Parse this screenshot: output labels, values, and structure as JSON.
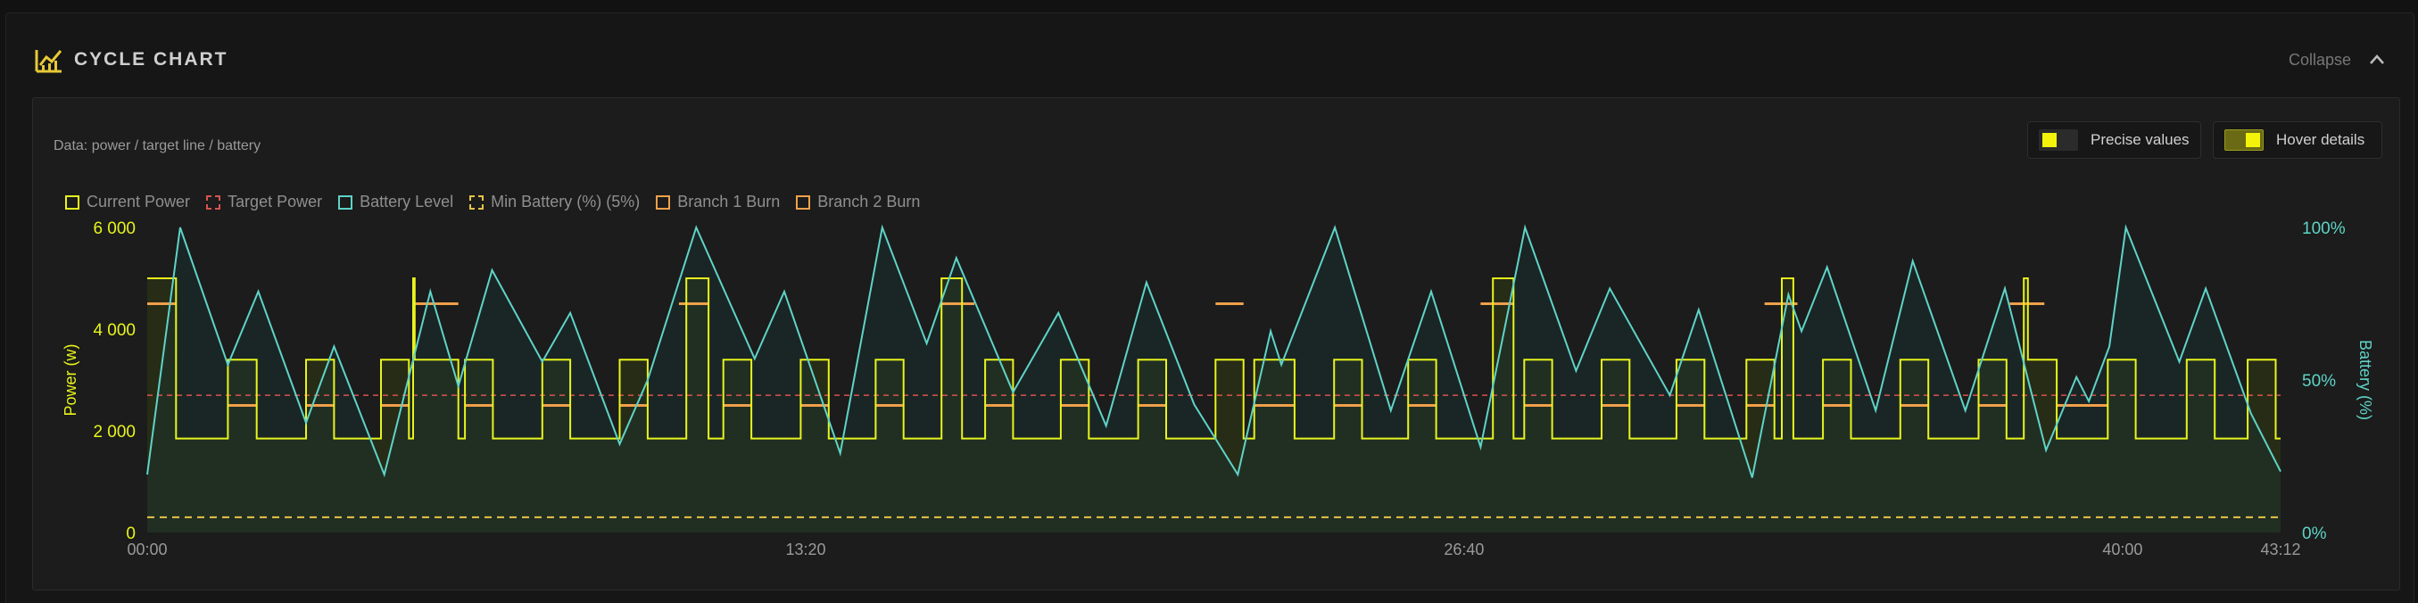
{
  "header": {
    "title": "CYCLE CHART",
    "icon": "chart-line-icon",
    "collapse_label": "Collapse",
    "collapse_icon": "chevron-up-icon"
  },
  "panel": {
    "subtitle": "Data: power / target line / battery",
    "precise_label": "Precise values",
    "precise_on": false,
    "hover_label": "Hover details",
    "hover_on": true
  },
  "colors": {
    "power": "#e8f41c",
    "target": "#d9534f",
    "battery": "#5fd3c8",
    "min_battery": "#e8c347",
    "branch1": "#f0a04b",
    "branch2": "#f0a04b"
  },
  "legend": [
    {
      "label": "Current Power",
      "style": "solid",
      "color": "#e8f41c"
    },
    {
      "label": "Target Power",
      "style": "dashed",
      "color": "#d9534f"
    },
    {
      "label": "Battery Level",
      "style": "solid",
      "color": "#5fd3c8"
    },
    {
      "label": "Min Battery (%) (5%)",
      "style": "dashed",
      "color": "#e8c347"
    },
    {
      "label": "Branch 1 Burn",
      "style": "solid",
      "color": "#f0a04b"
    },
    {
      "label": "Branch 2 Burn",
      "style": "solid",
      "color": "#f0a04b"
    }
  ],
  "chart_data": {
    "type": "line",
    "xlabel": "",
    "ylabel_left": "Power (w)",
    "ylabel_right": "Battery (%)",
    "x_ticks": [
      "00:00",
      "13:20",
      "26:40",
      "40:00",
      "43:12"
    ],
    "x_tick_seconds": [
      0,
      800,
      1600,
      2400,
      2592
    ],
    "xlim_seconds": [
      0,
      2592
    ],
    "y_left_ticks": [
      "0",
      "2 000",
      "4 000",
      "6 000"
    ],
    "y_left_tick_values": [
      0,
      2000,
      4000,
      6000
    ],
    "ylim_left": [
      0,
      6000
    ],
    "y_right_ticks": [
      "0%",
      "50%",
      "100%"
    ],
    "y_right_tick_values": [
      0,
      50,
      100
    ],
    "ylim_right": [
      0,
      100
    ],
    "grid": false,
    "legend_position": "top-left",
    "target_power": 2700,
    "min_battery_pct": 5,
    "series": [
      {
        "name": "Current Power",
        "shape": "step",
        "filled": true,
        "points": [
          [
            0,
            5000
          ],
          [
            35,
            5000
          ],
          [
            35,
            1850
          ],
          [
            98,
            1850
          ],
          [
            98,
            3400
          ],
          [
            133,
            3400
          ],
          [
            133,
            1850
          ],
          [
            193,
            1850
          ],
          [
            193,
            3400
          ],
          [
            227,
            3400
          ],
          [
            227,
            1850
          ],
          [
            284,
            1850
          ],
          [
            284,
            3400
          ],
          [
            318,
            3400
          ],
          [
            318,
            1850
          ],
          [
            323,
            1850
          ],
          [
            323,
            5000
          ],
          [
            325,
            5000
          ],
          [
            325,
            3400
          ],
          [
            378,
            3400
          ],
          [
            378,
            1850
          ],
          [
            386,
            1850
          ],
          [
            386,
            3400
          ],
          [
            420,
            3400
          ],
          [
            420,
            1850
          ],
          [
            480,
            1850
          ],
          [
            480,
            3400
          ],
          [
            514,
            3400
          ],
          [
            514,
            1850
          ],
          [
            574,
            1850
          ],
          [
            574,
            3400
          ],
          [
            608,
            3400
          ],
          [
            608,
            1850
          ],
          [
            655,
            1850
          ],
          [
            655,
            5000
          ],
          [
            682,
            5000
          ],
          [
            682,
            1850
          ],
          [
            700,
            1850
          ],
          [
            700,
            3400
          ],
          [
            734,
            3400
          ],
          [
            734,
            1850
          ],
          [
            794,
            1850
          ],
          [
            794,
            3400
          ],
          [
            828,
            3400
          ],
          [
            828,
            1850
          ],
          [
            885,
            1850
          ],
          [
            885,
            3400
          ],
          [
            919,
            3400
          ],
          [
            919,
            1850
          ],
          [
            965,
            1850
          ],
          [
            965,
            5000
          ],
          [
            990,
            5000
          ],
          [
            990,
            1850
          ],
          [
            1018,
            1850
          ],
          [
            1018,
            3400
          ],
          [
            1052,
            3400
          ],
          [
            1052,
            1850
          ],
          [
            1110,
            1850
          ],
          [
            1110,
            3400
          ],
          [
            1144,
            3400
          ],
          [
            1144,
            1850
          ],
          [
            1204,
            1850
          ],
          [
            1204,
            3400
          ],
          [
            1238,
            3400
          ],
          [
            1238,
            1850
          ],
          [
            1298,
            1850
          ],
          [
            1298,
            3400
          ],
          [
            1332,
            3400
          ],
          [
            1332,
            1850
          ],
          [
            1345,
            1850
          ],
          [
            1345,
            3400
          ],
          [
            1394,
            3400
          ],
          [
            1394,
            1850
          ],
          [
            1442,
            1850
          ],
          [
            1442,
            3400
          ],
          [
            1476,
            3400
          ],
          [
            1476,
            1850
          ],
          [
            1532,
            1850
          ],
          [
            1532,
            3400
          ],
          [
            1566,
            3400
          ],
          [
            1566,
            1850
          ],
          [
            1635,
            1850
          ],
          [
            1635,
            5000
          ],
          [
            1660,
            5000
          ],
          [
            1660,
            1850
          ],
          [
            1673,
            1850
          ],
          [
            1673,
            3400
          ],
          [
            1707,
            3400
          ],
          [
            1707,
            1850
          ],
          [
            1767,
            1850
          ],
          [
            1767,
            3400
          ],
          [
            1801,
            3400
          ],
          [
            1801,
            1850
          ],
          [
            1858,
            1850
          ],
          [
            1858,
            3400
          ],
          [
            1892,
            3400
          ],
          [
            1892,
            1850
          ],
          [
            1943,
            1850
          ],
          [
            1943,
            3400
          ],
          [
            1977,
            3400
          ],
          [
            1977,
            1850
          ],
          [
            1986,
            1850
          ],
          [
            1986,
            5000
          ],
          [
            2000,
            5000
          ],
          [
            2000,
            1850
          ],
          [
            2036,
            1850
          ],
          [
            2036,
            3400
          ],
          [
            2070,
            3400
          ],
          [
            2070,
            1850
          ],
          [
            2130,
            1850
          ],
          [
            2130,
            3400
          ],
          [
            2164,
            3400
          ],
          [
            2164,
            1850
          ],
          [
            2225,
            1850
          ],
          [
            2225,
            3400
          ],
          [
            2259,
            3400
          ],
          [
            2259,
            1850
          ],
          [
            2280,
            1850
          ],
          [
            2280,
            5000
          ],
          [
            2285,
            5000
          ],
          [
            2285,
            3400
          ],
          [
            2320,
            3400
          ],
          [
            2320,
            1850
          ],
          [
            2382,
            1850
          ],
          [
            2382,
            3400
          ],
          [
            2416,
            3400
          ],
          [
            2416,
            1850
          ],
          [
            2478,
            1850
          ],
          [
            2478,
            3400
          ],
          [
            2512,
            3400
          ],
          [
            2512,
            1850
          ],
          [
            2552,
            1850
          ],
          [
            2552,
            3400
          ],
          [
            2586,
            3400
          ],
          [
            2586,
            1850
          ],
          [
            2592,
            1850
          ]
        ]
      },
      {
        "name": "Battery Level",
        "axis": "right",
        "filled": true,
        "points": [
          [
            0,
            19
          ],
          [
            40,
            100
          ],
          [
            98,
            55
          ],
          [
            135,
            79
          ],
          [
            193,
            36
          ],
          [
            227,
            61
          ],
          [
            288,
            19
          ],
          [
            344,
            79
          ],
          [
            378,
            48
          ],
          [
            419,
            86
          ],
          [
            480,
            56
          ],
          [
            514,
            72
          ],
          [
            574,
            29
          ],
          [
            608,
            50
          ],
          [
            667,
            100
          ],
          [
            738,
            57
          ],
          [
            774,
            79
          ],
          [
            842,
            26
          ],
          [
            893,
            100
          ],
          [
            947,
            62
          ],
          [
            983,
            90
          ],
          [
            1052,
            46
          ],
          [
            1107,
            72
          ],
          [
            1165,
            35
          ],
          [
            1214,
            82
          ],
          [
            1272,
            42
          ],
          [
            1325,
            19
          ],
          [
            1365,
            66
          ],
          [
            1378,
            55
          ],
          [
            1443,
            100
          ],
          [
            1511,
            40
          ],
          [
            1560,
            79
          ],
          [
            1620,
            28
          ],
          [
            1674,
            100
          ],
          [
            1736,
            53
          ],
          [
            1777,
            80
          ],
          [
            1850,
            45
          ],
          [
            1885,
            73
          ],
          [
            1950,
            18
          ],
          [
            1994,
            78
          ],
          [
            2010,
            66
          ],
          [
            2041,
            87
          ],
          [
            2100,
            40
          ],
          [
            2145,
            89
          ],
          [
            2209,
            40
          ],
          [
            2257,
            80
          ],
          [
            2307,
            27
          ],
          [
            2344,
            51
          ],
          [
            2359,
            43
          ],
          [
            2384,
            61
          ],
          [
            2404,
            100
          ],
          [
            2469,
            56
          ],
          [
            2501,
            80
          ],
          [
            2556,
            39
          ],
          [
            2592,
            20
          ]
        ]
      },
      {
        "name": "Branch 1 Burn",
        "shape": "segments",
        "segments": [
          [
            [
              0,
              4500
            ],
            [
              35,
              4500
            ]
          ],
          [
            [
              98,
              2500
            ],
            [
              133,
              2500
            ]
          ],
          [
            [
              193,
              2500
            ],
            [
              227,
              2500
            ]
          ],
          [
            [
              284,
              2500
            ],
            [
              318,
              2500
            ]
          ],
          [
            [
              323,
              4500
            ],
            [
              378,
              4500
            ]
          ],
          [
            [
              386,
              2500
            ],
            [
              420,
              2500
            ]
          ],
          [
            [
              480,
              2500
            ],
            [
              514,
              2500
            ]
          ],
          [
            [
              574,
              2500
            ],
            [
              608,
              2500
            ]
          ],
          [
            [
              646,
              4500
            ],
            [
              682,
              4500
            ]
          ],
          [
            [
              700,
              2500
            ],
            [
              734,
              2500
            ]
          ],
          [
            [
              794,
              2500
            ],
            [
              828,
              2500
            ]
          ],
          [
            [
              885,
              2500
            ],
            [
              919,
              2500
            ]
          ],
          [
            [
              965,
              4500
            ],
            [
              1005,
              4500
            ]
          ],
          [
            [
              1018,
              2500
            ],
            [
              1052,
              2500
            ]
          ],
          [
            [
              1110,
              2500
            ],
            [
              1144,
              2500
            ]
          ],
          [
            [
              1204,
              2500
            ],
            [
              1238,
              2500
            ]
          ],
          [
            [
              1298,
              4500
            ],
            [
              1332,
              4500
            ]
          ]
        ]
      },
      {
        "name": "Branch 2 Burn",
        "shape": "segments",
        "segments": [
          [
            [
              1345,
              2500
            ],
            [
              1394,
              2500
            ]
          ],
          [
            [
              1442,
              2500
            ],
            [
              1476,
              2500
            ]
          ],
          [
            [
              1532,
              2500
            ],
            [
              1566,
              2500
            ]
          ],
          [
            [
              1620,
              4500
            ],
            [
              1660,
              4500
            ]
          ],
          [
            [
              1673,
              2500
            ],
            [
              1707,
              2500
            ]
          ],
          [
            [
              1767,
              2500
            ],
            [
              1801,
              2500
            ]
          ],
          [
            [
              1858,
              2500
            ],
            [
              1892,
              2500
            ]
          ],
          [
            [
              1943,
              2500
            ],
            [
              1977,
              2500
            ]
          ],
          [
            [
              1965,
              4500
            ],
            [
              2005,
              4500
            ]
          ],
          [
            [
              2036,
              2500
            ],
            [
              2070,
              2500
            ]
          ],
          [
            [
              2130,
              2500
            ],
            [
              2164,
              2500
            ]
          ],
          [
            [
              2225,
              2500
            ],
            [
              2259,
              2500
            ]
          ],
          [
            [
              2263,
              4500
            ],
            [
              2305,
              4500
            ]
          ],
          [
            [
              2320,
              2500
            ],
            [
              2382,
              2500
            ]
          ]
        ]
      }
    ]
  }
}
